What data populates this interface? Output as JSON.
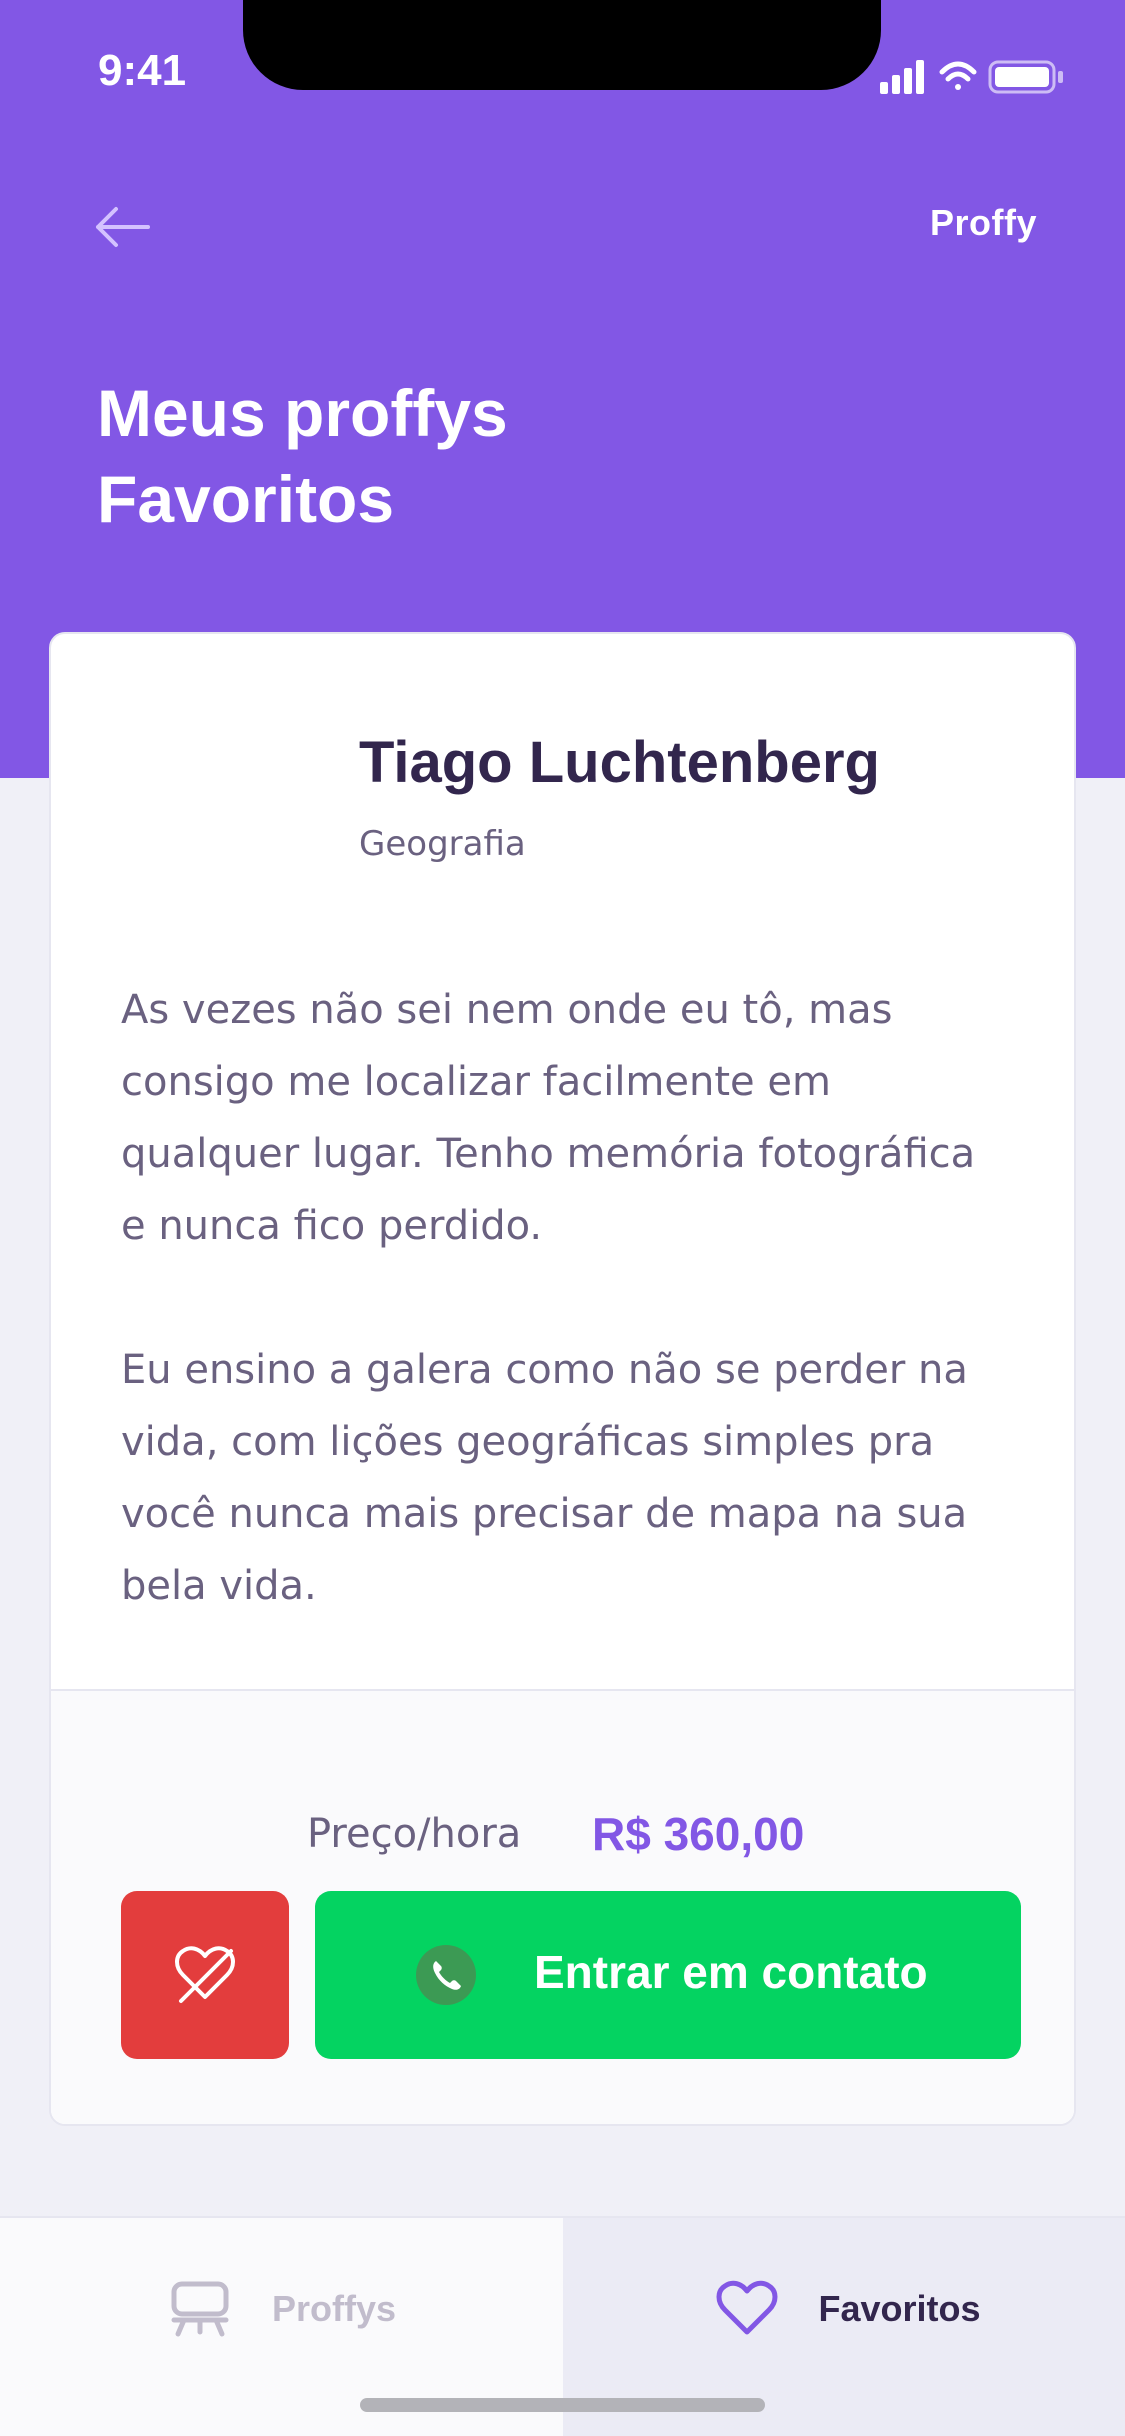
{
  "status_bar": {
    "time": "9:41"
  },
  "header": {
    "brand": "Proffy",
    "title_line1": "Meus proffys",
    "title_line2": "Favoritos"
  },
  "teacher_card": {
    "name": "Tiago Luchtenberg",
    "subject": "Geografia",
    "bio_paragraph1": "As vezes não sei nem onde eu tô, mas consigo me localizar facilmente em qualquer lugar. Tenho memória fotográfica e nunca fico perdido.",
    "bio_paragraph2": "Eu ensino a galera como não se perder na vida, com lições geográficas simples pra você nunca mais precisar de mapa na sua bela vida.",
    "price_label": "Preço/hora",
    "price_value": "R$ 360,00",
    "contact_button_label": "Entrar em contato"
  },
  "tab_bar": {
    "tabs": [
      {
        "label": "Proffys",
        "icon": "easel-icon",
        "active": false
      },
      {
        "label": "Favoritos",
        "icon": "heart-icon",
        "active": true
      }
    ]
  },
  "colors": {
    "primary": "#8257E5",
    "background": "#F0F0F7",
    "danger": "#E33D3D",
    "success": "#04D361",
    "title_text": "#32264D",
    "body_text": "#6A6180"
  }
}
